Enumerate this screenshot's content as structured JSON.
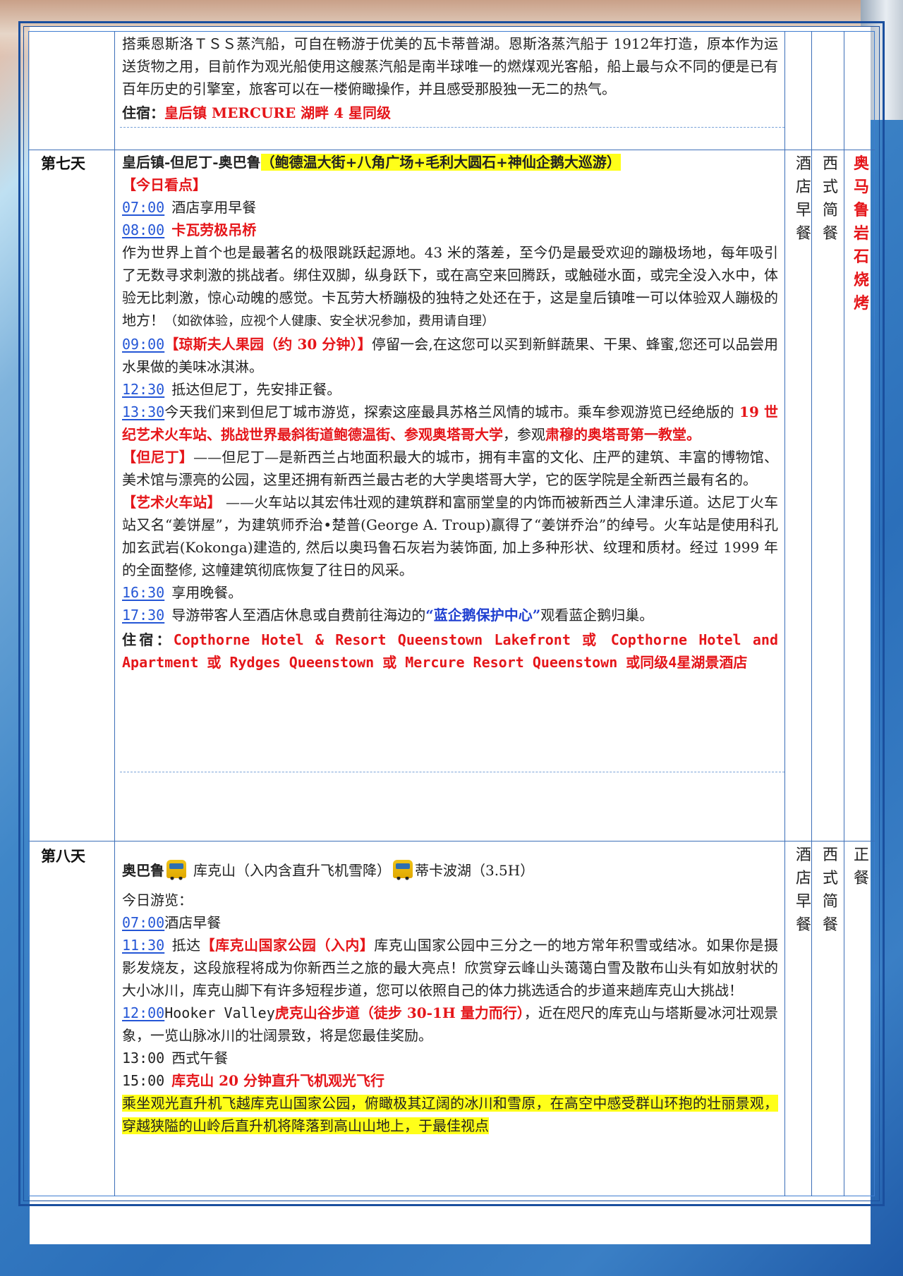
{
  "day6_tail": {
    "paragraph": "搭乘恩斯洛ＴＳＳ蒸汽船，可自在畅游于优美的瓦卡蒂普湖。恩斯洛蒸汽船于 1912年打造，原本作为运送货物之用，目前作为观光船使用这艘蒸汽船是南半球唯一的燃煤观光客船，船上最与众不同的便是已有百年历史的引擎室，旅客可以在一楼俯瞰操作，并且感受那股独一无二的热气。",
    "stay_label": "住宿：",
    "stay_value": "皇后镇 MERCURE 湖畔 4 星同级"
  },
  "day7": {
    "label": "第七天",
    "title": "皇后镇-但尼丁-奥巴鲁",
    "title_hl": "（鲍德温大街+八角广场+毛利大圆石+神仙企鹅大巡游）",
    "highlight_header": "【今日看点】",
    "t1": "07:00",
    "t1_text": "酒店享用早餐",
    "t2": "08:00",
    "t2_text": "卡瓦劳极吊桥",
    "p1": "作为世界上首个也是最著名的极限跳跃起源地。43 米的落差，至今仍是最受欢迎的蹦极场地，每年吸引了无数寻求刺激的挑战者。绑住双脚，纵身跃下，或在高空来回腾跃，或触碰水面，或完全没入水中，体验无比刺激，惊心动魄的感觉。卡瓦劳大桥蹦极的独特之处还在于，这是皇后镇唯一可以体验双人蹦极的地方！",
    "p1_small": "（如欲体验，应视个人健康、安全状况参加，费用请自理）",
    "t3": "09:00",
    "t3_red": "【琼斯夫人果园（约 30 分钟）】",
    "t3_text": "停留一会,在这您可以买到新鲜蔬果、干果、蜂蜜,您还可以品尝用水果做的美味冰淇淋。",
    "t4": "12:30",
    "t4_text": "抵达但尼丁，先安排正餐。",
    "t5": "13:30",
    "t5_text_a": "今天我们来到但尼丁城市游览，探索这座最具苏格兰风情的城市。乘车参观游览已经绝版的",
    "t5_red_a": " 19 世纪艺术火车站、挑战世界最斜街道鲍德温街、参观奥塔哥大学",
    "t5_text_b": "，参观",
    "t5_red_b": "肃穆的奥塔哥第一教堂。",
    "dun_head": "【但尼丁】",
    "dun_text": "——但尼丁—是新西兰占地面积最大的城市，拥有丰富的文化、庄严的建筑、丰富的博物馆、美术馆与漂亮的公园，这里还拥有新西兰最古老的大学奥塔哥大学，它的医学院是全新西兰最有名的。",
    "art_head": "【艺术火车站】",
    "art_text": " ——火车站以其宏伟壮观的建筑群和富丽堂皇的内饰而被新西兰人津津乐道。达尼丁火车站又名“姜饼屋”，为建筑师乔治•楚普(George A. Troup)赢得了“姜饼乔治”的绰号。火车站是使用科孔加玄武岩(Kokonga)建造的, 然后以奥玛鲁石灰岩为装饰面, 加上多种形状、纹理和质材。经过 1999 年的全面整修, 这幢建筑彻底恢复了往日的风采。",
    "t6": "16:30",
    "t6_text": "享用晚餐。",
    "t7": "17:30",
    "t7_text_a": "导游带客人至酒店休息或自费前往海边的",
    "t7_blue": "“蓝企鹅保护中心”",
    "t7_text_b": "观看蓝企鹅归巢。",
    "stay_label": "住宿：",
    "stay_value": "Copthorne Hotel & Resort Queenstown Lakefront 或 Copthorne Hotel and Apartment 或 Rydges Queenstown 或 Mercure Resort Queenstown 或同级4星湖景酒店",
    "breakfast": "酒店早餐",
    "lunch": "西式简餐",
    "dinner": "奥马鲁岩石烧烤"
  },
  "day8": {
    "label": "第八天",
    "route_a": "奥巴鲁",
    "route_b": "库克山（入内含直升飞机雪降）",
    "route_c": "蒂卡波湖（3.5H）",
    "tour_header": "今日游览：",
    "t1": "07:00",
    "t1_text": "酒店早餐",
    "t2": "11:30",
    "t2_text_a": "抵达",
    "t2_red": "【库克山国家公园（入内】",
    "t2_text_b": "库克山国家公园中三分之一的地方常年积雪或结冰。如果你是摄影发烧友，这段旅程将成为你新西兰之旅的最大亮点！欣赏穿云峰山头蔼蔼白雪及散布山头有如放射状的大小冰川，库克山脚下有许多短程步道，您可以依照自己的体力挑选适合的步道来趟库克山大挑战！",
    "t3": "12:00",
    "t3_text_a": "Hooker Valley",
    "t3_red": "虎克山谷步道（徒步 30-1H 量力而行）",
    "t3_text_b": "，近在咫尺的库克山与塔斯曼冰河壮观景象，一览山脉冰川的壮阔景致，将是您最佳奖励。",
    "t4": "13:00",
    "t4_text": "西式午餐",
    "t5": "15:00",
    "t5_red": "库克山 20 分钟直升飞机观光飞行",
    "hl_para": "乘坐观光直升机飞越库克山国家公园，俯瞰极其辽阔的冰川和雪原，在高空中感受群山环抱的壮丽景观，穿越狭隘的山岭后直升机将降落到高山山地上，于最佳视点",
    "breakfast": "酒店早餐",
    "lunch": "西式简餐",
    "dinner": "正餐"
  },
  "colors": {
    "accent_red": "#e5161a",
    "time_blue": "#2456d6",
    "highlight": "#ffff19",
    "frame_blue": "#1a4f9e"
  }
}
